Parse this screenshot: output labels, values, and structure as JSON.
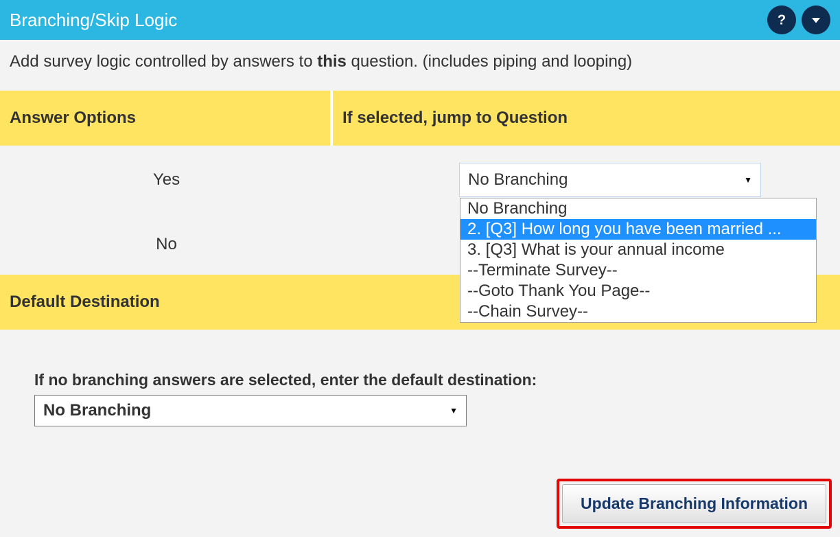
{
  "header": {
    "title": "Branching/Skip Logic"
  },
  "intro": {
    "prefix": "Add survey logic controlled by answers to ",
    "bold": "this",
    "suffix": " question. (includes piping and looping)"
  },
  "table": {
    "columns": {
      "answer_options": "Answer Options",
      "jump_to": "If selected, jump to Question"
    },
    "rows": [
      {
        "label": "Yes",
        "selected": "No Branching"
      },
      {
        "label": "No",
        "selected": ""
      }
    ]
  },
  "dropdown": {
    "options": [
      "No Branching",
      "2. [Q3] How long you have been married ...",
      "3. [Q3] What is your annual income",
      "--Terminate Survey--",
      "--Goto Thank You Page--",
      "--Chain Survey--"
    ],
    "highlighted_index": 1
  },
  "default_section": {
    "header": "Default Destination",
    "label": "If no branching answers are selected, enter the default destination:",
    "selected": "No Branching"
  },
  "footer": {
    "button": "Update Branching Information"
  }
}
